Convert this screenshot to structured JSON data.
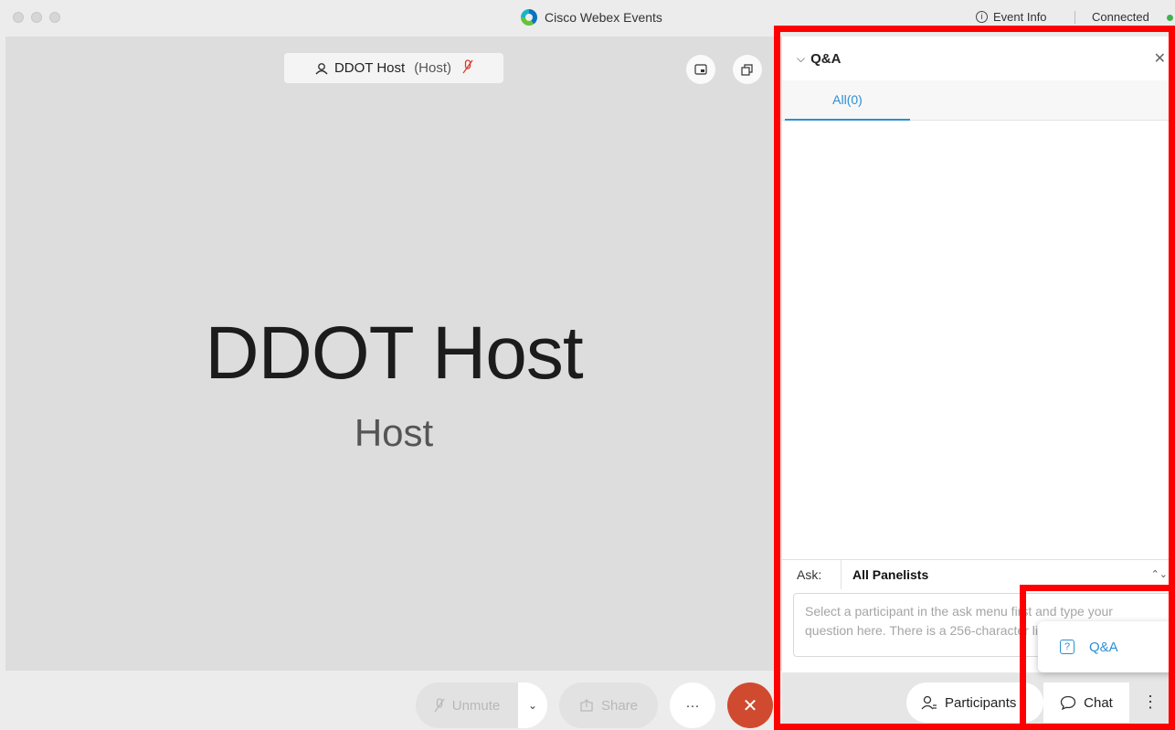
{
  "window": {
    "title": "Cisco Webex Events",
    "event_info": "Event Info",
    "status": "Connected"
  },
  "stage": {
    "host_name": "DDOT Host",
    "host_role_tag": "(Host)",
    "big_name": "DDOT Host",
    "big_role": "Host"
  },
  "controls": {
    "unmute": "Unmute",
    "share": "Share",
    "more": "···",
    "leave": "✕"
  },
  "qa_panel": {
    "title": "Q&A",
    "tab_all": "All(0)",
    "ask_label": "Ask:",
    "ask_target": "All Panelists",
    "question_placeholder": "Select a participant in the ask menu first and type your question here. There is a 256-character limit."
  },
  "footer": {
    "participants": "Participants",
    "chat": "Chat"
  },
  "popup_menu": {
    "qa_item": "Q&A"
  },
  "colors": {
    "accent": "#2a8fd4",
    "leave": "#d04a2f",
    "highlight": "#ff0000",
    "connected": "#3eb34a"
  }
}
